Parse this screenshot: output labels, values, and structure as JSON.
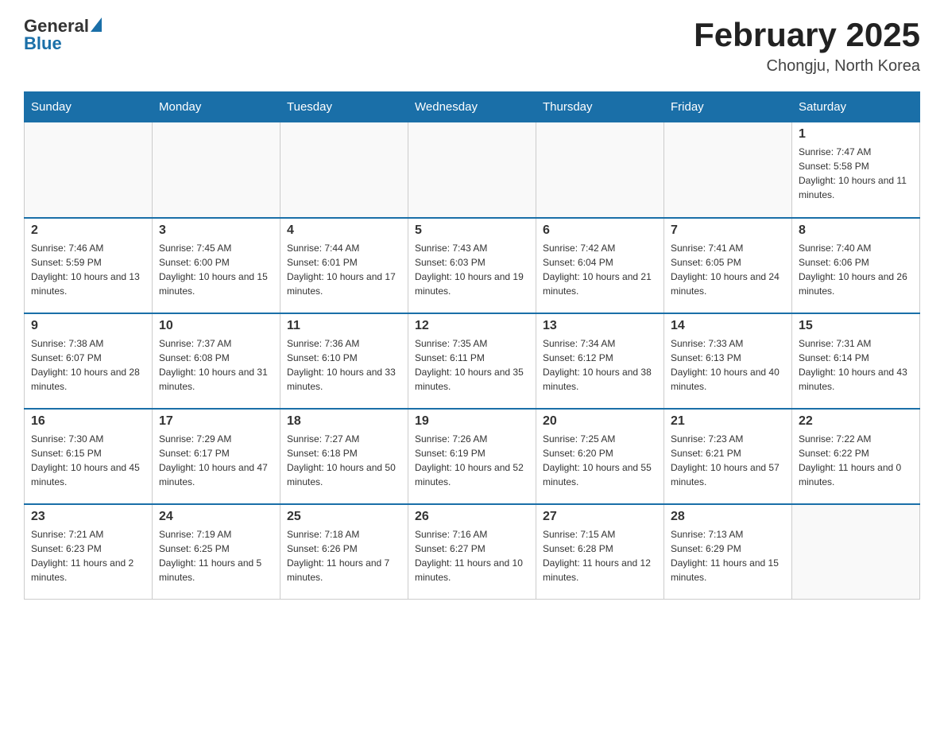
{
  "logo": {
    "general": "General",
    "blue": "Blue"
  },
  "title": "February 2025",
  "subtitle": "Chongju, North Korea",
  "days_of_week": [
    "Sunday",
    "Monday",
    "Tuesday",
    "Wednesday",
    "Thursday",
    "Friday",
    "Saturday"
  ],
  "weeks": [
    [
      {
        "day": "",
        "info": ""
      },
      {
        "day": "",
        "info": ""
      },
      {
        "day": "",
        "info": ""
      },
      {
        "day": "",
        "info": ""
      },
      {
        "day": "",
        "info": ""
      },
      {
        "day": "",
        "info": ""
      },
      {
        "day": "1",
        "info": "Sunrise: 7:47 AM\nSunset: 5:58 PM\nDaylight: 10 hours and 11 minutes."
      }
    ],
    [
      {
        "day": "2",
        "info": "Sunrise: 7:46 AM\nSunset: 5:59 PM\nDaylight: 10 hours and 13 minutes."
      },
      {
        "day": "3",
        "info": "Sunrise: 7:45 AM\nSunset: 6:00 PM\nDaylight: 10 hours and 15 minutes."
      },
      {
        "day": "4",
        "info": "Sunrise: 7:44 AM\nSunset: 6:01 PM\nDaylight: 10 hours and 17 minutes."
      },
      {
        "day": "5",
        "info": "Sunrise: 7:43 AM\nSunset: 6:03 PM\nDaylight: 10 hours and 19 minutes."
      },
      {
        "day": "6",
        "info": "Sunrise: 7:42 AM\nSunset: 6:04 PM\nDaylight: 10 hours and 21 minutes."
      },
      {
        "day": "7",
        "info": "Sunrise: 7:41 AM\nSunset: 6:05 PM\nDaylight: 10 hours and 24 minutes."
      },
      {
        "day": "8",
        "info": "Sunrise: 7:40 AM\nSunset: 6:06 PM\nDaylight: 10 hours and 26 minutes."
      }
    ],
    [
      {
        "day": "9",
        "info": "Sunrise: 7:38 AM\nSunset: 6:07 PM\nDaylight: 10 hours and 28 minutes."
      },
      {
        "day": "10",
        "info": "Sunrise: 7:37 AM\nSunset: 6:08 PM\nDaylight: 10 hours and 31 minutes."
      },
      {
        "day": "11",
        "info": "Sunrise: 7:36 AM\nSunset: 6:10 PM\nDaylight: 10 hours and 33 minutes."
      },
      {
        "day": "12",
        "info": "Sunrise: 7:35 AM\nSunset: 6:11 PM\nDaylight: 10 hours and 35 minutes."
      },
      {
        "day": "13",
        "info": "Sunrise: 7:34 AM\nSunset: 6:12 PM\nDaylight: 10 hours and 38 minutes."
      },
      {
        "day": "14",
        "info": "Sunrise: 7:33 AM\nSunset: 6:13 PM\nDaylight: 10 hours and 40 minutes."
      },
      {
        "day": "15",
        "info": "Sunrise: 7:31 AM\nSunset: 6:14 PM\nDaylight: 10 hours and 43 minutes."
      }
    ],
    [
      {
        "day": "16",
        "info": "Sunrise: 7:30 AM\nSunset: 6:15 PM\nDaylight: 10 hours and 45 minutes."
      },
      {
        "day": "17",
        "info": "Sunrise: 7:29 AM\nSunset: 6:17 PM\nDaylight: 10 hours and 47 minutes."
      },
      {
        "day": "18",
        "info": "Sunrise: 7:27 AM\nSunset: 6:18 PM\nDaylight: 10 hours and 50 minutes."
      },
      {
        "day": "19",
        "info": "Sunrise: 7:26 AM\nSunset: 6:19 PM\nDaylight: 10 hours and 52 minutes."
      },
      {
        "day": "20",
        "info": "Sunrise: 7:25 AM\nSunset: 6:20 PM\nDaylight: 10 hours and 55 minutes."
      },
      {
        "day": "21",
        "info": "Sunrise: 7:23 AM\nSunset: 6:21 PM\nDaylight: 10 hours and 57 minutes."
      },
      {
        "day": "22",
        "info": "Sunrise: 7:22 AM\nSunset: 6:22 PM\nDaylight: 11 hours and 0 minutes."
      }
    ],
    [
      {
        "day": "23",
        "info": "Sunrise: 7:21 AM\nSunset: 6:23 PM\nDaylight: 11 hours and 2 minutes."
      },
      {
        "day": "24",
        "info": "Sunrise: 7:19 AM\nSunset: 6:25 PM\nDaylight: 11 hours and 5 minutes."
      },
      {
        "day": "25",
        "info": "Sunrise: 7:18 AM\nSunset: 6:26 PM\nDaylight: 11 hours and 7 minutes."
      },
      {
        "day": "26",
        "info": "Sunrise: 7:16 AM\nSunset: 6:27 PM\nDaylight: 11 hours and 10 minutes."
      },
      {
        "day": "27",
        "info": "Sunrise: 7:15 AM\nSunset: 6:28 PM\nDaylight: 11 hours and 12 minutes."
      },
      {
        "day": "28",
        "info": "Sunrise: 7:13 AM\nSunset: 6:29 PM\nDaylight: 11 hours and 15 minutes."
      },
      {
        "day": "",
        "info": ""
      }
    ]
  ]
}
